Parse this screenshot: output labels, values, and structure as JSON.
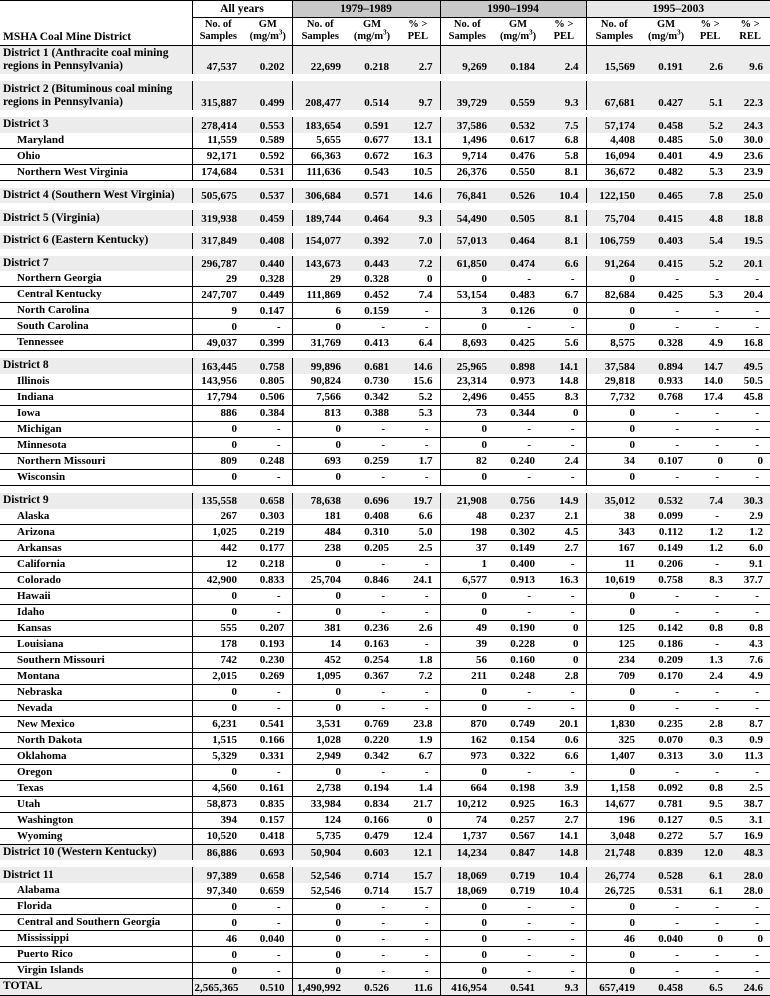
{
  "table": {
    "corner_label": "MSHA Coal Mine District",
    "groups": [
      {
        "label": "All years",
        "cols": [
          "No. of Samples",
          "GM (mg/m3)"
        ]
      },
      {
        "label": "1979–1989",
        "cols": [
          "No. of Samples",
          "GM (mg/m3)",
          "% > PEL"
        ]
      },
      {
        "label": "1990–1994",
        "cols": [
          "No. of Samples",
          "GM (mg/m3)",
          "% > PEL"
        ]
      },
      {
        "label": "1995–2003",
        "cols": [
          "No. of Samples",
          "GM (mg/m3)",
          "% > PEL",
          "% > REL"
        ]
      }
    ],
    "sub_headers": {
      "no_of": "No. of",
      "samples": "Samples",
      "gm": "GM",
      "unit": "(mg/m",
      "unit_sup": "3",
      "unit_close": ")",
      "pct": "% >",
      "pel": "PEL",
      "rel": "REL"
    },
    "rows": [
      {
        "kind": "district",
        "label": "District 1 (Anthracite coal mining regions in Pennsylvania)",
        "v": [
          "47,537",
          "0.202",
          "22,699",
          "0.218",
          "2.7",
          "9,269",
          "0.184",
          "2.4",
          "15,569",
          "0.191",
          "2.6",
          "9.6"
        ]
      },
      {
        "kind": "spacer"
      },
      {
        "kind": "district",
        "label": "District 2 (Bituminous coal mining regions in Pennsylvania)",
        "v": [
          "315,887",
          "0.499",
          "208,477",
          "0.514",
          "9.7",
          "39,729",
          "0.559",
          "9.3",
          "67,681",
          "0.427",
          "5.1",
          "22.3"
        ]
      },
      {
        "kind": "spacer"
      },
      {
        "kind": "district",
        "label": "District 3",
        "v": [
          "278,414",
          "0.553",
          "183,654",
          "0.591",
          "12.7",
          "37,586",
          "0.532",
          "7.5",
          "57,174",
          "0.458",
          "5.2",
          "24.3"
        ]
      },
      {
        "kind": "sub",
        "label": "Maryland",
        "v": [
          "11,559",
          "0.589",
          "5,655",
          "0.677",
          "13.1",
          "1,496",
          "0.617",
          "6.8",
          "4,408",
          "0.485",
          "5.0",
          "30.0"
        ]
      },
      {
        "kind": "sub",
        "label": "Ohio",
        "v": [
          "92,171",
          "0.592",
          "66,363",
          "0.672",
          "16.3",
          "9,714",
          "0.476",
          "5.8",
          "16,094",
          "0.401",
          "4.9",
          "23.6"
        ]
      },
      {
        "kind": "sub",
        "label": "Northern West Virginia",
        "v": [
          "174,684",
          "0.531",
          "111,636",
          "0.543",
          "10.5",
          "26,376",
          "0.550",
          "8.1",
          "36,672",
          "0.482",
          "5.3",
          "23.9"
        ]
      },
      {
        "kind": "spacer"
      },
      {
        "kind": "district",
        "label": "District 4 (Southern West Virginia)",
        "v": [
          "505,675",
          "0.537",
          "306,684",
          "0.571",
          "14.6",
          "76,841",
          "0.526",
          "10.4",
          "122,150",
          "0.465",
          "7.8",
          "25.0"
        ]
      },
      {
        "kind": "spacer"
      },
      {
        "kind": "district",
        "label": "District 5 (Virginia)",
        "v": [
          "319,938",
          "0.459",
          "189,744",
          "0.464",
          "9.3",
          "54,490",
          "0.505",
          "8.1",
          "75,704",
          "0.415",
          "4.8",
          "18.8"
        ]
      },
      {
        "kind": "spacer"
      },
      {
        "kind": "district",
        "label": "District 6 (Eastern Kentucky)",
        "v": [
          "317,849",
          "0.408",
          "154,077",
          "0.392",
          "7.0",
          "57,013",
          "0.464",
          "8.1",
          "106,759",
          "0.403",
          "5.4",
          "19.5"
        ]
      },
      {
        "kind": "spacer"
      },
      {
        "kind": "district",
        "label": "District 7",
        "v": [
          "296,787",
          "0.440",
          "143,673",
          "0.443",
          "7.2",
          "61,850",
          "0.474",
          "6.6",
          "91,264",
          "0.415",
          "5.2",
          "20.1"
        ]
      },
      {
        "kind": "sub",
        "label": "Northern Georgia",
        "v": [
          "29",
          "0.328",
          "29",
          "0.328",
          "0",
          "0",
          "-",
          "-",
          "0",
          "-",
          "-",
          "-"
        ]
      },
      {
        "kind": "sub",
        "label": "Central Kentucky",
        "v": [
          "247,707",
          "0.449",
          "111,869",
          "0.452",
          "7.4",
          "53,154",
          "0.483",
          "6.7",
          "82,684",
          "0.425",
          "5.3",
          "20.4"
        ]
      },
      {
        "kind": "sub",
        "label": "North Carolina",
        "v": [
          "9",
          "0.147",
          "6",
          "0.159",
          "-",
          "3",
          "0.126",
          "0",
          "0",
          "-",
          "-",
          "-"
        ]
      },
      {
        "kind": "sub",
        "label": "South Carolina",
        "v": [
          "0",
          "-",
          "0",
          "-",
          "-",
          "0",
          "-",
          "-",
          "0",
          "-",
          "-",
          "-"
        ]
      },
      {
        "kind": "sub",
        "label": "Tennessee",
        "v": [
          "49,037",
          "0.399",
          "31,769",
          "0.413",
          "6.4",
          "8,693",
          "0.425",
          "5.6",
          "8,575",
          "0.328",
          "4.9",
          "16.8"
        ]
      },
      {
        "kind": "spacer"
      },
      {
        "kind": "district",
        "label": "District 8",
        "v": [
          "163,445",
          "0.758",
          "99,896",
          "0.681",
          "14.6",
          "25,965",
          "0.898",
          "14.1",
          "37,584",
          "0.894",
          "14.7",
          "49.5"
        ]
      },
      {
        "kind": "sub",
        "label": "Illinois",
        "v": [
          "143,956",
          "0.805",
          "90,824",
          "0.730",
          "15.6",
          "23,314",
          "0.973",
          "14.8",
          "29,818",
          "0.933",
          "14.0",
          "50.5"
        ]
      },
      {
        "kind": "sub",
        "label": "Indiana",
        "v": [
          "17,794",
          "0.506",
          "7,566",
          "0.342",
          "5.2",
          "2,496",
          "0.455",
          "8.3",
          "7,732",
          "0.768",
          "17.4",
          "45.8"
        ]
      },
      {
        "kind": "sub",
        "label": "Iowa",
        "v": [
          "886",
          "0.384",
          "813",
          "0.388",
          "5.3",
          "73",
          "0.344",
          "0",
          "0",
          "-",
          "-",
          "-"
        ]
      },
      {
        "kind": "sub",
        "label": "Michigan",
        "v": [
          "0",
          "-",
          "0",
          "-",
          "-",
          "0",
          "-",
          "-",
          "0",
          "-",
          "-",
          "-"
        ]
      },
      {
        "kind": "sub",
        "label": "Minnesota",
        "v": [
          "0",
          "-",
          "0",
          "-",
          "-",
          "0",
          "-",
          "-",
          "0",
          "-",
          "-",
          "-"
        ]
      },
      {
        "kind": "sub",
        "label": "Northern Missouri",
        "v": [
          "809",
          "0.248",
          "693",
          "0.259",
          "1.7",
          "82",
          "0.240",
          "2.4",
          "34",
          "0.107",
          "0",
          "0"
        ]
      },
      {
        "kind": "sub",
        "label": "Wisconsin",
        "v": [
          "0",
          "-",
          "0",
          "-",
          "-",
          "0",
          "-",
          "-",
          "0",
          "-",
          "-",
          "-"
        ]
      },
      {
        "kind": "spacer"
      },
      {
        "kind": "district",
        "label": "District 9",
        "v": [
          "135,558",
          "0.658",
          "78,638",
          "0.696",
          "19.7",
          "21,908",
          "0.756",
          "14.9",
          "35,012",
          "0.532",
          "7.4",
          "30.3"
        ]
      },
      {
        "kind": "sub",
        "label": "Alaska",
        "v": [
          "267",
          "0.303",
          "181",
          "0.408",
          "6.6",
          "48",
          "0.237",
          "2.1",
          "38",
          "0.099",
          "-",
          "2.9"
        ]
      },
      {
        "kind": "sub",
        "label": "Arizona",
        "v": [
          "1,025",
          "0.219",
          "484",
          "0.310",
          "5.0",
          "198",
          "0.302",
          "4.5",
          "343",
          "0.112",
          "1.2",
          "1.2"
        ]
      },
      {
        "kind": "sub",
        "label": "Arkansas",
        "v": [
          "442",
          "0.177",
          "238",
          "0.205",
          "2.5",
          "37",
          "0.149",
          "2.7",
          "167",
          "0.149",
          "1.2",
          "6.0"
        ]
      },
      {
        "kind": "sub",
        "label": "California",
        "v": [
          "12",
          "0.218",
          "0",
          "-",
          "-",
          "1",
          "0.400",
          "-",
          "11",
          "0.206",
          "-",
          "9.1"
        ]
      },
      {
        "kind": "sub",
        "label": "Colorado",
        "v": [
          "42,900",
          "0.833",
          "25,704",
          "0.846",
          "24.1",
          "6,577",
          "0.913",
          "16.3",
          "10,619",
          "0.758",
          "8.3",
          "37.7"
        ]
      },
      {
        "kind": "sub",
        "label": "Hawaii",
        "v": [
          "0",
          "-",
          "0",
          "-",
          "-",
          "0",
          "-",
          "-",
          "0",
          "-",
          "-",
          "-"
        ]
      },
      {
        "kind": "sub",
        "label": "Idaho",
        "v": [
          "0",
          "-",
          "0",
          "-",
          "-",
          "0",
          "-",
          "-",
          "0",
          "-",
          "-",
          "-"
        ]
      },
      {
        "kind": "sub",
        "label": "Kansas",
        "v": [
          "555",
          "0.207",
          "381",
          "0.236",
          "2.6",
          "49",
          "0.190",
          "0",
          "125",
          "0.142",
          "0.8",
          "0.8"
        ]
      },
      {
        "kind": "sub",
        "label": "Louisiana",
        "v": [
          "178",
          "0.193",
          "14",
          "0.163",
          "-",
          "39",
          "0.228",
          "0",
          "125",
          "0.186",
          "-",
          "4.3"
        ]
      },
      {
        "kind": "sub",
        "label": "Southern Missouri",
        "v": [
          "742",
          "0.230",
          "452",
          "0.254",
          "1.8",
          "56",
          "0.160",
          "0",
          "234",
          "0.209",
          "1.3",
          "7.6"
        ]
      },
      {
        "kind": "sub",
        "label": "Montana",
        "v": [
          "2,015",
          "0.269",
          "1,095",
          "0.367",
          "7.2",
          "211",
          "0.248",
          "2.8",
          "709",
          "0.170",
          "2.4",
          "4.9"
        ]
      },
      {
        "kind": "sub",
        "label": "Nebraska",
        "v": [
          "0",
          "-",
          "0",
          "-",
          "-",
          "0",
          "-",
          "-",
          "0",
          "-",
          "-",
          "-"
        ]
      },
      {
        "kind": "sub",
        "label": "Nevada",
        "v": [
          "0",
          "-",
          "0",
          "-",
          "-",
          "0",
          "-",
          "-",
          "0",
          "-",
          "-",
          "-"
        ]
      },
      {
        "kind": "sub",
        "label": "New Mexico",
        "v": [
          "6,231",
          "0.541",
          "3,531",
          "0.769",
          "23.8",
          "870",
          "0.749",
          "20.1",
          "1,830",
          "0.235",
          "2.8",
          "8.7"
        ]
      },
      {
        "kind": "sub",
        "label": "North Dakota",
        "v": [
          "1,515",
          "0.166",
          "1,028",
          "0.220",
          "1.9",
          "162",
          "0.154",
          "0.6",
          "325",
          "0.070",
          "0.3",
          "0.9"
        ]
      },
      {
        "kind": "sub",
        "label": "Oklahoma",
        "v": [
          "5,329",
          "0.331",
          "2,949",
          "0.342",
          "6.7",
          "973",
          "0.322",
          "6.6",
          "1,407",
          "0.313",
          "3.0",
          "11.3"
        ]
      },
      {
        "kind": "sub",
        "label": "Oregon",
        "v": [
          "0",
          "-",
          "0",
          "-",
          "-",
          "0",
          "-",
          "-",
          "0",
          "-",
          "-",
          "-"
        ]
      },
      {
        "kind": "sub",
        "label": "Texas",
        "v": [
          "4,560",
          "0.161",
          "2,738",
          "0.194",
          "1.4",
          "664",
          "0.198",
          "3.9",
          "1,158",
          "0.092",
          "0.8",
          "2.5"
        ]
      },
      {
        "kind": "sub",
        "label": "Utah",
        "v": [
          "58,873",
          "0.835",
          "33,984",
          "0.834",
          "21.7",
          "10,212",
          "0.925",
          "16.3",
          "14,677",
          "0.781",
          "9.5",
          "38.7"
        ]
      },
      {
        "kind": "sub",
        "label": "Washington",
        "v": [
          "394",
          "0.157",
          "124",
          "0.166",
          "0",
          "74",
          "0.257",
          "2.7",
          "196",
          "0.127",
          "0.5",
          "3.1"
        ]
      },
      {
        "kind": "sub",
        "label": "Wyoming",
        "v": [
          "10,520",
          "0.418",
          "5,735",
          "0.479",
          "12.4",
          "1,737",
          "0.567",
          "14.1",
          "3,048",
          "0.272",
          "5.7",
          "16.9"
        ]
      },
      {
        "kind": "district",
        "label": "District 10 (Western Kentucky)",
        "v": [
          "86,886",
          "0.693",
          "50,904",
          "0.603",
          "12.1",
          "14,234",
          "0.847",
          "14.8",
          "21,748",
          "0.839",
          "12.0",
          "48.3"
        ]
      },
      {
        "kind": "spacer"
      },
      {
        "kind": "district",
        "label": "District 11",
        "v": [
          "97,389",
          "0.658",
          "52,546",
          "0.714",
          "15.7",
          "18,069",
          "0.719",
          "10.4",
          "26,774",
          "0.528",
          "6.1",
          "28.0"
        ]
      },
      {
        "kind": "sub",
        "label": "Alabama",
        "v": [
          "97,340",
          "0.659",
          "52,546",
          "0.714",
          "15.7",
          "18,069",
          "0.719",
          "10.4",
          "26,725",
          "0.531",
          "6.1",
          "28.0"
        ]
      },
      {
        "kind": "sub",
        "label": "Florida",
        "v": [
          "0",
          "-",
          "0",
          "-",
          "-",
          "0",
          "-",
          "-",
          "0",
          "-",
          "-",
          "-"
        ]
      },
      {
        "kind": "sub",
        "label": "Central and Southern Georgia",
        "v": [
          "0",
          "-",
          "0",
          "-",
          "-",
          "0",
          "-",
          "-",
          "0",
          "-",
          "-",
          "-"
        ]
      },
      {
        "kind": "sub",
        "label": "Mississippi",
        "v": [
          "46",
          "0.040",
          "0",
          "-",
          "-",
          "0",
          "-",
          "-",
          "46",
          "0.040",
          "0",
          "0"
        ]
      },
      {
        "kind": "sub",
        "label": "Puerto Rico",
        "v": [
          "0",
          "-",
          "0",
          "-",
          "-",
          "0",
          "-",
          "-",
          "0",
          "-",
          "-",
          "-"
        ]
      },
      {
        "kind": "sub",
        "label": "Virgin Islands",
        "v": [
          "0",
          "-",
          "0",
          "-",
          "-",
          "0",
          "-",
          "-",
          "0",
          "-",
          "-",
          "-"
        ]
      },
      {
        "kind": "total",
        "label": "TOTAL",
        "v": [
          "2,565,365",
          "0.510",
          "1,490,992",
          "0.526",
          "11.6",
          "416,954",
          "0.541",
          "9.3",
          "657,419",
          "0.458",
          "6.5",
          "24.6"
        ]
      }
    ]
  }
}
